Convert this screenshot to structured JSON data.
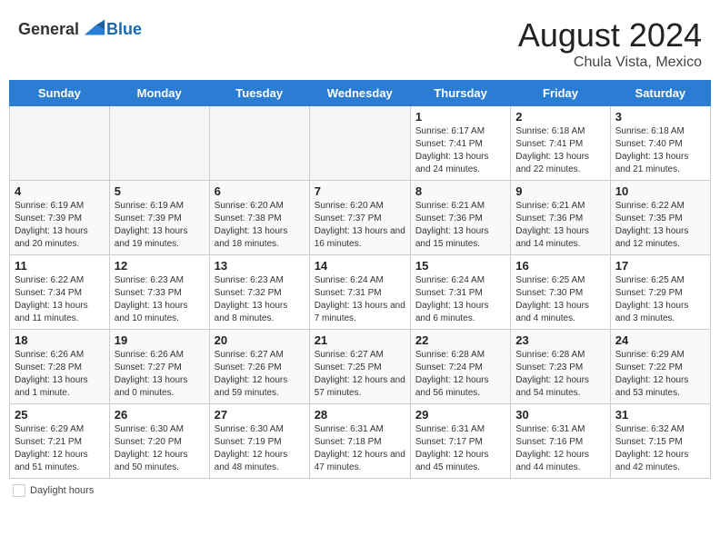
{
  "header": {
    "logo_general": "General",
    "logo_blue": "Blue",
    "month_year": "August 2024",
    "location": "Chula Vista, Mexico"
  },
  "weekdays": [
    "Sunday",
    "Monday",
    "Tuesday",
    "Wednesday",
    "Thursday",
    "Friday",
    "Saturday"
  ],
  "footer": {
    "label": "Daylight hours"
  },
  "weeks": [
    [
      {
        "day": "",
        "sunrise": "",
        "sunset": "",
        "daylight": "",
        "empty": true
      },
      {
        "day": "",
        "sunrise": "",
        "sunset": "",
        "daylight": "",
        "empty": true
      },
      {
        "day": "",
        "sunrise": "",
        "sunset": "",
        "daylight": "",
        "empty": true
      },
      {
        "day": "",
        "sunrise": "",
        "sunset": "",
        "daylight": "",
        "empty": true
      },
      {
        "day": "1",
        "sunrise": "Sunrise: 6:17 AM",
        "sunset": "Sunset: 7:41 PM",
        "daylight": "Daylight: 13 hours and 24 minutes.",
        "empty": false
      },
      {
        "day": "2",
        "sunrise": "Sunrise: 6:18 AM",
        "sunset": "Sunset: 7:41 PM",
        "daylight": "Daylight: 13 hours and 22 minutes.",
        "empty": false
      },
      {
        "day": "3",
        "sunrise": "Sunrise: 6:18 AM",
        "sunset": "Sunset: 7:40 PM",
        "daylight": "Daylight: 13 hours and 21 minutes.",
        "empty": false
      }
    ],
    [
      {
        "day": "4",
        "sunrise": "Sunrise: 6:19 AM",
        "sunset": "Sunset: 7:39 PM",
        "daylight": "Daylight: 13 hours and 20 minutes.",
        "empty": false
      },
      {
        "day": "5",
        "sunrise": "Sunrise: 6:19 AM",
        "sunset": "Sunset: 7:39 PM",
        "daylight": "Daylight: 13 hours and 19 minutes.",
        "empty": false
      },
      {
        "day": "6",
        "sunrise": "Sunrise: 6:20 AM",
        "sunset": "Sunset: 7:38 PM",
        "daylight": "Daylight: 13 hours and 18 minutes.",
        "empty": false
      },
      {
        "day": "7",
        "sunrise": "Sunrise: 6:20 AM",
        "sunset": "Sunset: 7:37 PM",
        "daylight": "Daylight: 13 hours and 16 minutes.",
        "empty": false
      },
      {
        "day": "8",
        "sunrise": "Sunrise: 6:21 AM",
        "sunset": "Sunset: 7:36 PM",
        "daylight": "Daylight: 13 hours and 15 minutes.",
        "empty": false
      },
      {
        "day": "9",
        "sunrise": "Sunrise: 6:21 AM",
        "sunset": "Sunset: 7:36 PM",
        "daylight": "Daylight: 13 hours and 14 minutes.",
        "empty": false
      },
      {
        "day": "10",
        "sunrise": "Sunrise: 6:22 AM",
        "sunset": "Sunset: 7:35 PM",
        "daylight": "Daylight: 13 hours and 12 minutes.",
        "empty": false
      }
    ],
    [
      {
        "day": "11",
        "sunrise": "Sunrise: 6:22 AM",
        "sunset": "Sunset: 7:34 PM",
        "daylight": "Daylight: 13 hours and 11 minutes.",
        "empty": false
      },
      {
        "day": "12",
        "sunrise": "Sunrise: 6:23 AM",
        "sunset": "Sunset: 7:33 PM",
        "daylight": "Daylight: 13 hours and 10 minutes.",
        "empty": false
      },
      {
        "day": "13",
        "sunrise": "Sunrise: 6:23 AM",
        "sunset": "Sunset: 7:32 PM",
        "daylight": "Daylight: 13 hours and 8 minutes.",
        "empty": false
      },
      {
        "day": "14",
        "sunrise": "Sunrise: 6:24 AM",
        "sunset": "Sunset: 7:31 PM",
        "daylight": "Daylight: 13 hours and 7 minutes.",
        "empty": false
      },
      {
        "day": "15",
        "sunrise": "Sunrise: 6:24 AM",
        "sunset": "Sunset: 7:31 PM",
        "daylight": "Daylight: 13 hours and 6 minutes.",
        "empty": false
      },
      {
        "day": "16",
        "sunrise": "Sunrise: 6:25 AM",
        "sunset": "Sunset: 7:30 PM",
        "daylight": "Daylight: 13 hours and 4 minutes.",
        "empty": false
      },
      {
        "day": "17",
        "sunrise": "Sunrise: 6:25 AM",
        "sunset": "Sunset: 7:29 PM",
        "daylight": "Daylight: 13 hours and 3 minutes.",
        "empty": false
      }
    ],
    [
      {
        "day": "18",
        "sunrise": "Sunrise: 6:26 AM",
        "sunset": "Sunset: 7:28 PM",
        "daylight": "Daylight: 13 hours and 1 minute.",
        "empty": false
      },
      {
        "day": "19",
        "sunrise": "Sunrise: 6:26 AM",
        "sunset": "Sunset: 7:27 PM",
        "daylight": "Daylight: 13 hours and 0 minutes.",
        "empty": false
      },
      {
        "day": "20",
        "sunrise": "Sunrise: 6:27 AM",
        "sunset": "Sunset: 7:26 PM",
        "daylight": "Daylight: 12 hours and 59 minutes.",
        "empty": false
      },
      {
        "day": "21",
        "sunrise": "Sunrise: 6:27 AM",
        "sunset": "Sunset: 7:25 PM",
        "daylight": "Daylight: 12 hours and 57 minutes.",
        "empty": false
      },
      {
        "day": "22",
        "sunrise": "Sunrise: 6:28 AM",
        "sunset": "Sunset: 7:24 PM",
        "daylight": "Daylight: 12 hours and 56 minutes.",
        "empty": false
      },
      {
        "day": "23",
        "sunrise": "Sunrise: 6:28 AM",
        "sunset": "Sunset: 7:23 PM",
        "daylight": "Daylight: 12 hours and 54 minutes.",
        "empty": false
      },
      {
        "day": "24",
        "sunrise": "Sunrise: 6:29 AM",
        "sunset": "Sunset: 7:22 PM",
        "daylight": "Daylight: 12 hours and 53 minutes.",
        "empty": false
      }
    ],
    [
      {
        "day": "25",
        "sunrise": "Sunrise: 6:29 AM",
        "sunset": "Sunset: 7:21 PM",
        "daylight": "Daylight: 12 hours and 51 minutes.",
        "empty": false
      },
      {
        "day": "26",
        "sunrise": "Sunrise: 6:30 AM",
        "sunset": "Sunset: 7:20 PM",
        "daylight": "Daylight: 12 hours and 50 minutes.",
        "empty": false
      },
      {
        "day": "27",
        "sunrise": "Sunrise: 6:30 AM",
        "sunset": "Sunset: 7:19 PM",
        "daylight": "Daylight: 12 hours and 48 minutes.",
        "empty": false
      },
      {
        "day": "28",
        "sunrise": "Sunrise: 6:31 AM",
        "sunset": "Sunset: 7:18 PM",
        "daylight": "Daylight: 12 hours and 47 minutes.",
        "empty": false
      },
      {
        "day": "29",
        "sunrise": "Sunrise: 6:31 AM",
        "sunset": "Sunset: 7:17 PM",
        "daylight": "Daylight: 12 hours and 45 minutes.",
        "empty": false
      },
      {
        "day": "30",
        "sunrise": "Sunrise: 6:31 AM",
        "sunset": "Sunset: 7:16 PM",
        "daylight": "Daylight: 12 hours and 44 minutes.",
        "empty": false
      },
      {
        "day": "31",
        "sunrise": "Sunrise: 6:32 AM",
        "sunset": "Sunset: 7:15 PM",
        "daylight": "Daylight: 12 hours and 42 minutes.",
        "empty": false
      }
    ]
  ]
}
